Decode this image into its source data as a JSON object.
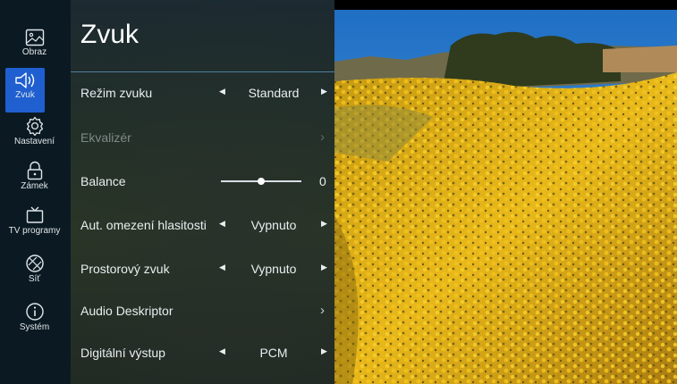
{
  "sidebar": {
    "items": [
      {
        "label": "Obraz",
        "icon": "image-icon",
        "active": false
      },
      {
        "label": "Zvuk",
        "icon": "speaker-icon",
        "active": true
      },
      {
        "label": "Nastavení",
        "icon": "gear-icon",
        "active": false
      },
      {
        "label": "Zámek",
        "icon": "lock-icon",
        "active": false
      },
      {
        "label": "TV programy",
        "icon": "tv-icon",
        "active": false
      },
      {
        "label": "Síť",
        "icon": "network-icon",
        "active": false
      },
      {
        "label": "Systém",
        "icon": "info-icon",
        "active": false
      }
    ]
  },
  "menu": {
    "title": "Zvuk",
    "rows": [
      {
        "label": "Režim zvuku",
        "value": "Standard",
        "type": "selector"
      },
      {
        "label": "Ekvalizér",
        "type": "submenu",
        "disabled": true
      },
      {
        "label": "Balance",
        "value": "0",
        "type": "slider",
        "level": 0.5
      },
      {
        "label": "Aut. omezení hlasitosti",
        "value": "Vypnuto",
        "type": "selector"
      },
      {
        "label": "Prostorový zvuk",
        "value": "Vypnuto",
        "type": "selector"
      },
      {
        "label": "Audio Deskriptor",
        "type": "submenu"
      },
      {
        "label": "Digitální výstup",
        "value": "PCM",
        "type": "selector"
      }
    ]
  },
  "colors": {
    "accent": "#1f5fd0",
    "rail_bg": "#0b1a22",
    "divider": "#4d7fa0"
  }
}
